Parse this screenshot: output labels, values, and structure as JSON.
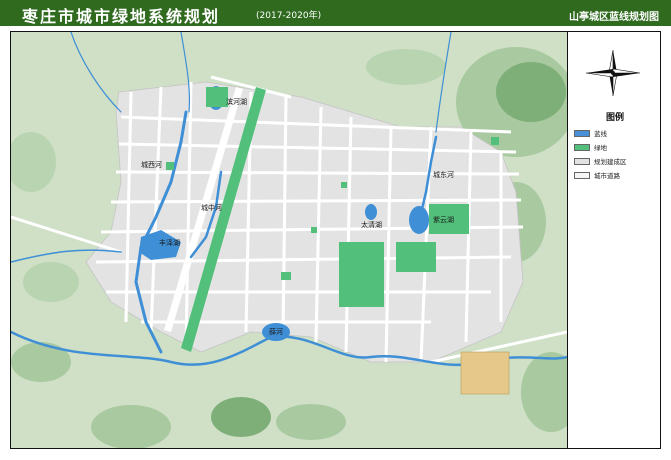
{
  "title": {
    "main": "枣庄市城市绿地系统规划",
    "years": "(2017-2020年)",
    "subtitle": "山亭城区蓝线规划图"
  },
  "legend": {
    "title": "图例",
    "items": [
      {
        "label": "蓝线",
        "color": "#4a90d9"
      },
      {
        "label": "绿地",
        "color": "#52c07a"
      },
      {
        "label": "规划建成区",
        "color": "#e2e2e2"
      },
      {
        "label": "城市道路",
        "color": "#f5f5f5"
      }
    ]
  },
  "map": {
    "labels": {
      "binhe": "滨河湖",
      "chengxi": "城西河",
      "chengzhong": "城中河",
      "fengze": "丰泽湖",
      "chengdong": "城东河",
      "taiqing": "太清湖",
      "ziyun": "紫云湖",
      "xuehe": "薛河"
    },
    "colors": {
      "terrain": "#cfe0c6",
      "hill": "#a9c9a0",
      "hill_dark": "#7faf78",
      "urban": "#e3e3e3",
      "road": "#ffffff",
      "water": "#3f8fd6",
      "green": "#52c07a",
      "tan": "#e5c88a"
    }
  }
}
